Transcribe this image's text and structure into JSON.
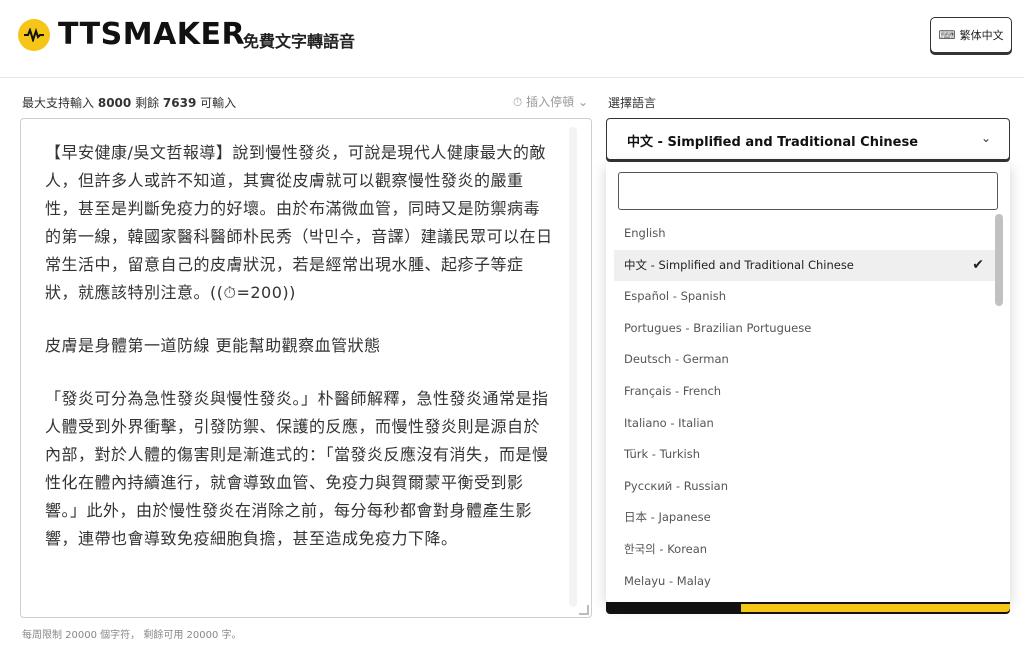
{
  "header": {
    "logo_text": "TTSMAKER",
    "tagline": "免費文字轉語音",
    "lang_toggle_label": "繁体中文"
  },
  "editor": {
    "limit_prefix": "最大支持輸入",
    "limit_max": "8000",
    "limit_mid": "剩餘",
    "limit_remaining": "7639",
    "limit_suffix": "可輸入",
    "pause_label": "插入停頓",
    "paragraphs": [
      "【早安健康/吳文哲報導】說到慢性發炎，可說是現代人健康最大的敵人，但許多人或許不知道，其實從皮膚就可以觀察慢性發炎的嚴重性，甚至是判斷免疫力的好壞。由於布滿微血管，同時又是防禦病毒的第一線，韓國家醫科醫師朴民秀（박민수，音譯）建議民眾可以在日常生活中，留意自己的皮膚狀況，若是經常出現水腫、起疹子等症狀，就應該特別注意。((⏱=200))",
      "皮膚是身體第一道防線 更能幫助觀察血管狀態",
      "「發炎可分為急性發炎與慢性發炎。」朴醫師解釋，急性發炎通常是指人體受到外界衝擊，引發防禦、保護的反應，而慢性發炎則是源自於內部，對於人體的傷害則是漸進式的：「當發炎反應沒有消失，而是慢性化在體內持續進行，就會導致血管、免疫力與賀爾蒙平衡受到影響。」此外，由於慢性發炎在消除之前，每分每秒都會對身體產生影響，連帶也會導致免疫細胞負擔，甚至造成免疫力下降。"
    ],
    "footer_note": "每周限制 20000 個字符， 剩餘可用 20000 字。"
  },
  "language": {
    "label": "選擇語言",
    "selected": "中文 - Simplified and Traditional Chinese",
    "search_value": "",
    "options": [
      "English",
      "中文 - Simplified and Traditional Chinese",
      "Español - Spanish",
      "Portugues - Brazilian Portuguese",
      "Deutsch - German",
      "Français - French",
      "Italiano - Italian",
      "Türk - Turkish",
      "Русский - Russian",
      "日本 - Japanese",
      "한국의 - Korean",
      "Melayu - Malay"
    ]
  },
  "colors": {
    "brand_yellow": "#f5c518",
    "dark": "#111111"
  }
}
